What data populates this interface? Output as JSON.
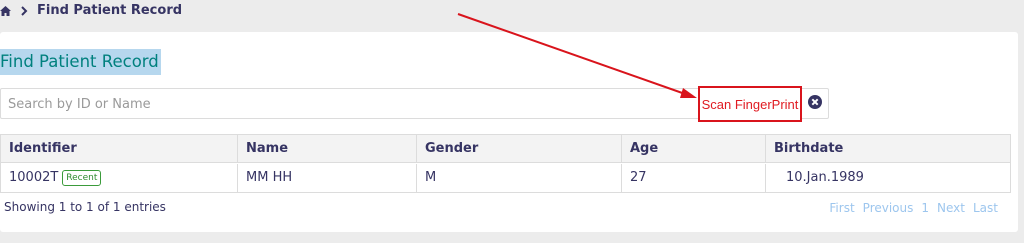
{
  "breadcrumb": {
    "home_icon": "home-icon",
    "current": "Find Patient Record"
  },
  "page": {
    "title": "Find Patient Record"
  },
  "search": {
    "placeholder": "Search by ID or Name",
    "value": "",
    "scan_label": "Scan FingerPrint",
    "clear_icon": "close-circle-icon"
  },
  "table": {
    "columns": [
      "Identifier",
      "Name",
      "Gender",
      "Age",
      "Birthdate"
    ],
    "rows": [
      {
        "identifier": "10002T",
        "badge": "Recent",
        "name": "MM HH",
        "gender": "M",
        "age": "27",
        "birthdate": "10.Jan.1989"
      }
    ]
  },
  "footer": {
    "showing": "Showing 1 to 1 of 1 entries",
    "pager": [
      "First",
      "Previous",
      "1",
      "Next",
      "Last"
    ]
  },
  "colors": {
    "title_text": "#00807e",
    "title_highlight": "#b6d7ee",
    "annotation": "#d9141c",
    "pager_link": "#9dc6ee",
    "header_text": "#363463"
  }
}
